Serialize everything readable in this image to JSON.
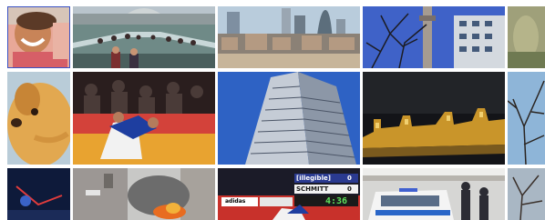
{
  "gallery": {
    "rows": 3,
    "selected_index": 0,
    "tiles": [
      {
        "id": "smiling-woman",
        "subject": "smiling woman portrait"
      },
      {
        "id": "millennium-bridge",
        "subject": "crowd on footbridge with city behind"
      },
      {
        "id": "city-skyline",
        "subject": "city skyline across the river"
      },
      {
        "id": "bt-tower",
        "subject": "tower behind bare tree and building"
      },
      {
        "id": "green-edge",
        "subject": "cropped green image"
      },
      {
        "id": "golden-dog",
        "subject": "golden retriever close-up"
      },
      {
        "id": "judo-match",
        "subject": "judo match on mat with photographers"
      },
      {
        "id": "glass-tower",
        "subject": "modern glass tower against blue sky"
      },
      {
        "id": "castle-night",
        "subject": "illuminated castle walls at night"
      },
      {
        "id": "bare-tree-edge",
        "subject": "bare tree against sky"
      },
      {
        "id": "fireworks",
        "subject": "night scene with red light"
      },
      {
        "id": "street-fire",
        "subject": "burning car on street"
      },
      {
        "id": "judo-scoreboard",
        "subject": "judo match with scoreboard"
      },
      {
        "id": "police-van",
        "subject": "police van in street"
      },
      {
        "id": "tree-edge",
        "subject": "tree branches"
      }
    ]
  },
  "scoreboard": {
    "name_top": "[illegible]",
    "score_top": "0",
    "name_bottom": "SCHMITT",
    "score_bottom": "0",
    "timer": "4:36",
    "sponsor": "adidas"
  }
}
